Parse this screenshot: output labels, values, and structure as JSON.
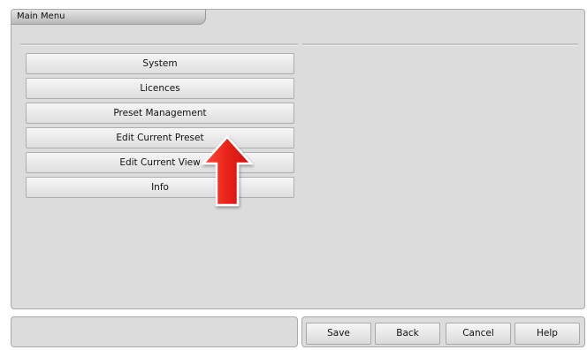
{
  "window": {
    "title": "Main Menu"
  },
  "menu": {
    "items": [
      {
        "label": "System"
      },
      {
        "label": "Licences"
      },
      {
        "label": "Preset Management"
      },
      {
        "label": "Edit Current Preset"
      },
      {
        "label": "Edit Current View"
      },
      {
        "label": "Info"
      }
    ]
  },
  "footer": {
    "buttons": {
      "save": "Save",
      "back": "Back",
      "cancel": "Cancel",
      "help": "Help"
    }
  },
  "annotation": {
    "icon": "up-arrow-icon",
    "color": "#e8241a"
  },
  "colors": {
    "panel": "#dcdcdc",
    "button_top": "#f6f6f6",
    "button_bottom": "#dedede",
    "border": "#a9a9a9"
  }
}
